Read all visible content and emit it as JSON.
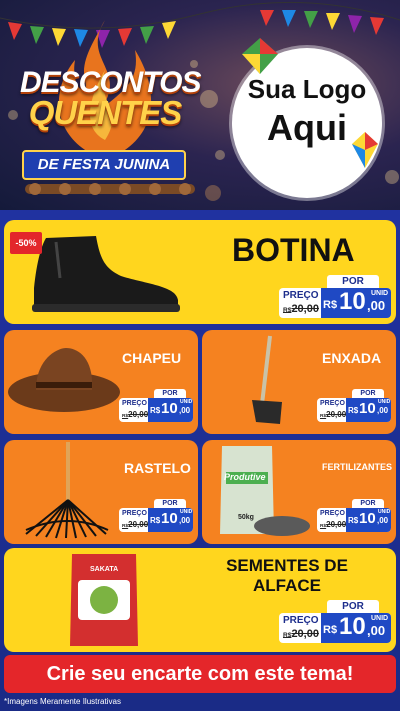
{
  "header": {
    "title_line1": "DESCONTOS",
    "title_line2": "QUENTES",
    "subtitle": "DE FESTA JUNINA",
    "logo_line1": "Sua Logo",
    "logo_line2": "Aqui"
  },
  "products": [
    {
      "name": "BOTINA",
      "discount": "-50%",
      "por": "POR",
      "preco": "PREÇO",
      "currency_old": "R$",
      "old_price": "20,00",
      "currency": "R$",
      "new_int": "10",
      "new_dec": ",00",
      "unit": "UNID"
    },
    {
      "name": "CHAPEU",
      "por": "POR",
      "preco": "PREÇO",
      "currency_old": "R$",
      "old_price": "20,00",
      "currency": "R$",
      "new_int": "10",
      "new_dec": ",00",
      "unit": "UNID"
    },
    {
      "name": "ENXADA",
      "por": "POR",
      "preco": "PREÇO",
      "currency_old": "R$",
      "old_price": "20,00",
      "currency": "R$",
      "new_int": "10",
      "new_dec": ",00",
      "unit": "UNID"
    },
    {
      "name": "RASTELO",
      "por": "POR",
      "preco": "PREÇO",
      "currency_old": "R$",
      "old_price": "20,00",
      "currency": "R$",
      "new_int": "10",
      "new_dec": ",00",
      "unit": "UNID"
    },
    {
      "name": "FERTILIZANTES",
      "por": "POR",
      "preco": "PREÇO",
      "currency_old": "R$",
      "old_price": "20,00",
      "currency": "R$",
      "new_int": "10",
      "new_dec": ",00",
      "unit": "UNID",
      "bag_brand": "Produtive",
      "bag_weight": "50kg"
    },
    {
      "name_line1": "SEMENTES DE",
      "name_line2": "ALFACE",
      "por": "POR",
      "preco": "PREÇO",
      "currency_old": "R$",
      "old_price": "20,00",
      "currency": "R$",
      "new_int": "10",
      "new_dec": ",00",
      "unit": "UNID",
      "pack_brand": "SAKATA"
    }
  ],
  "cta": "Crie seu encarte com este tema!",
  "disclaimer": "*Imagens Meramente Ilustrativas",
  "colors": {
    "yellow": "#ffd61e",
    "orange": "#f58220",
    "blue": "#1f49c4",
    "red": "#e4262a"
  }
}
